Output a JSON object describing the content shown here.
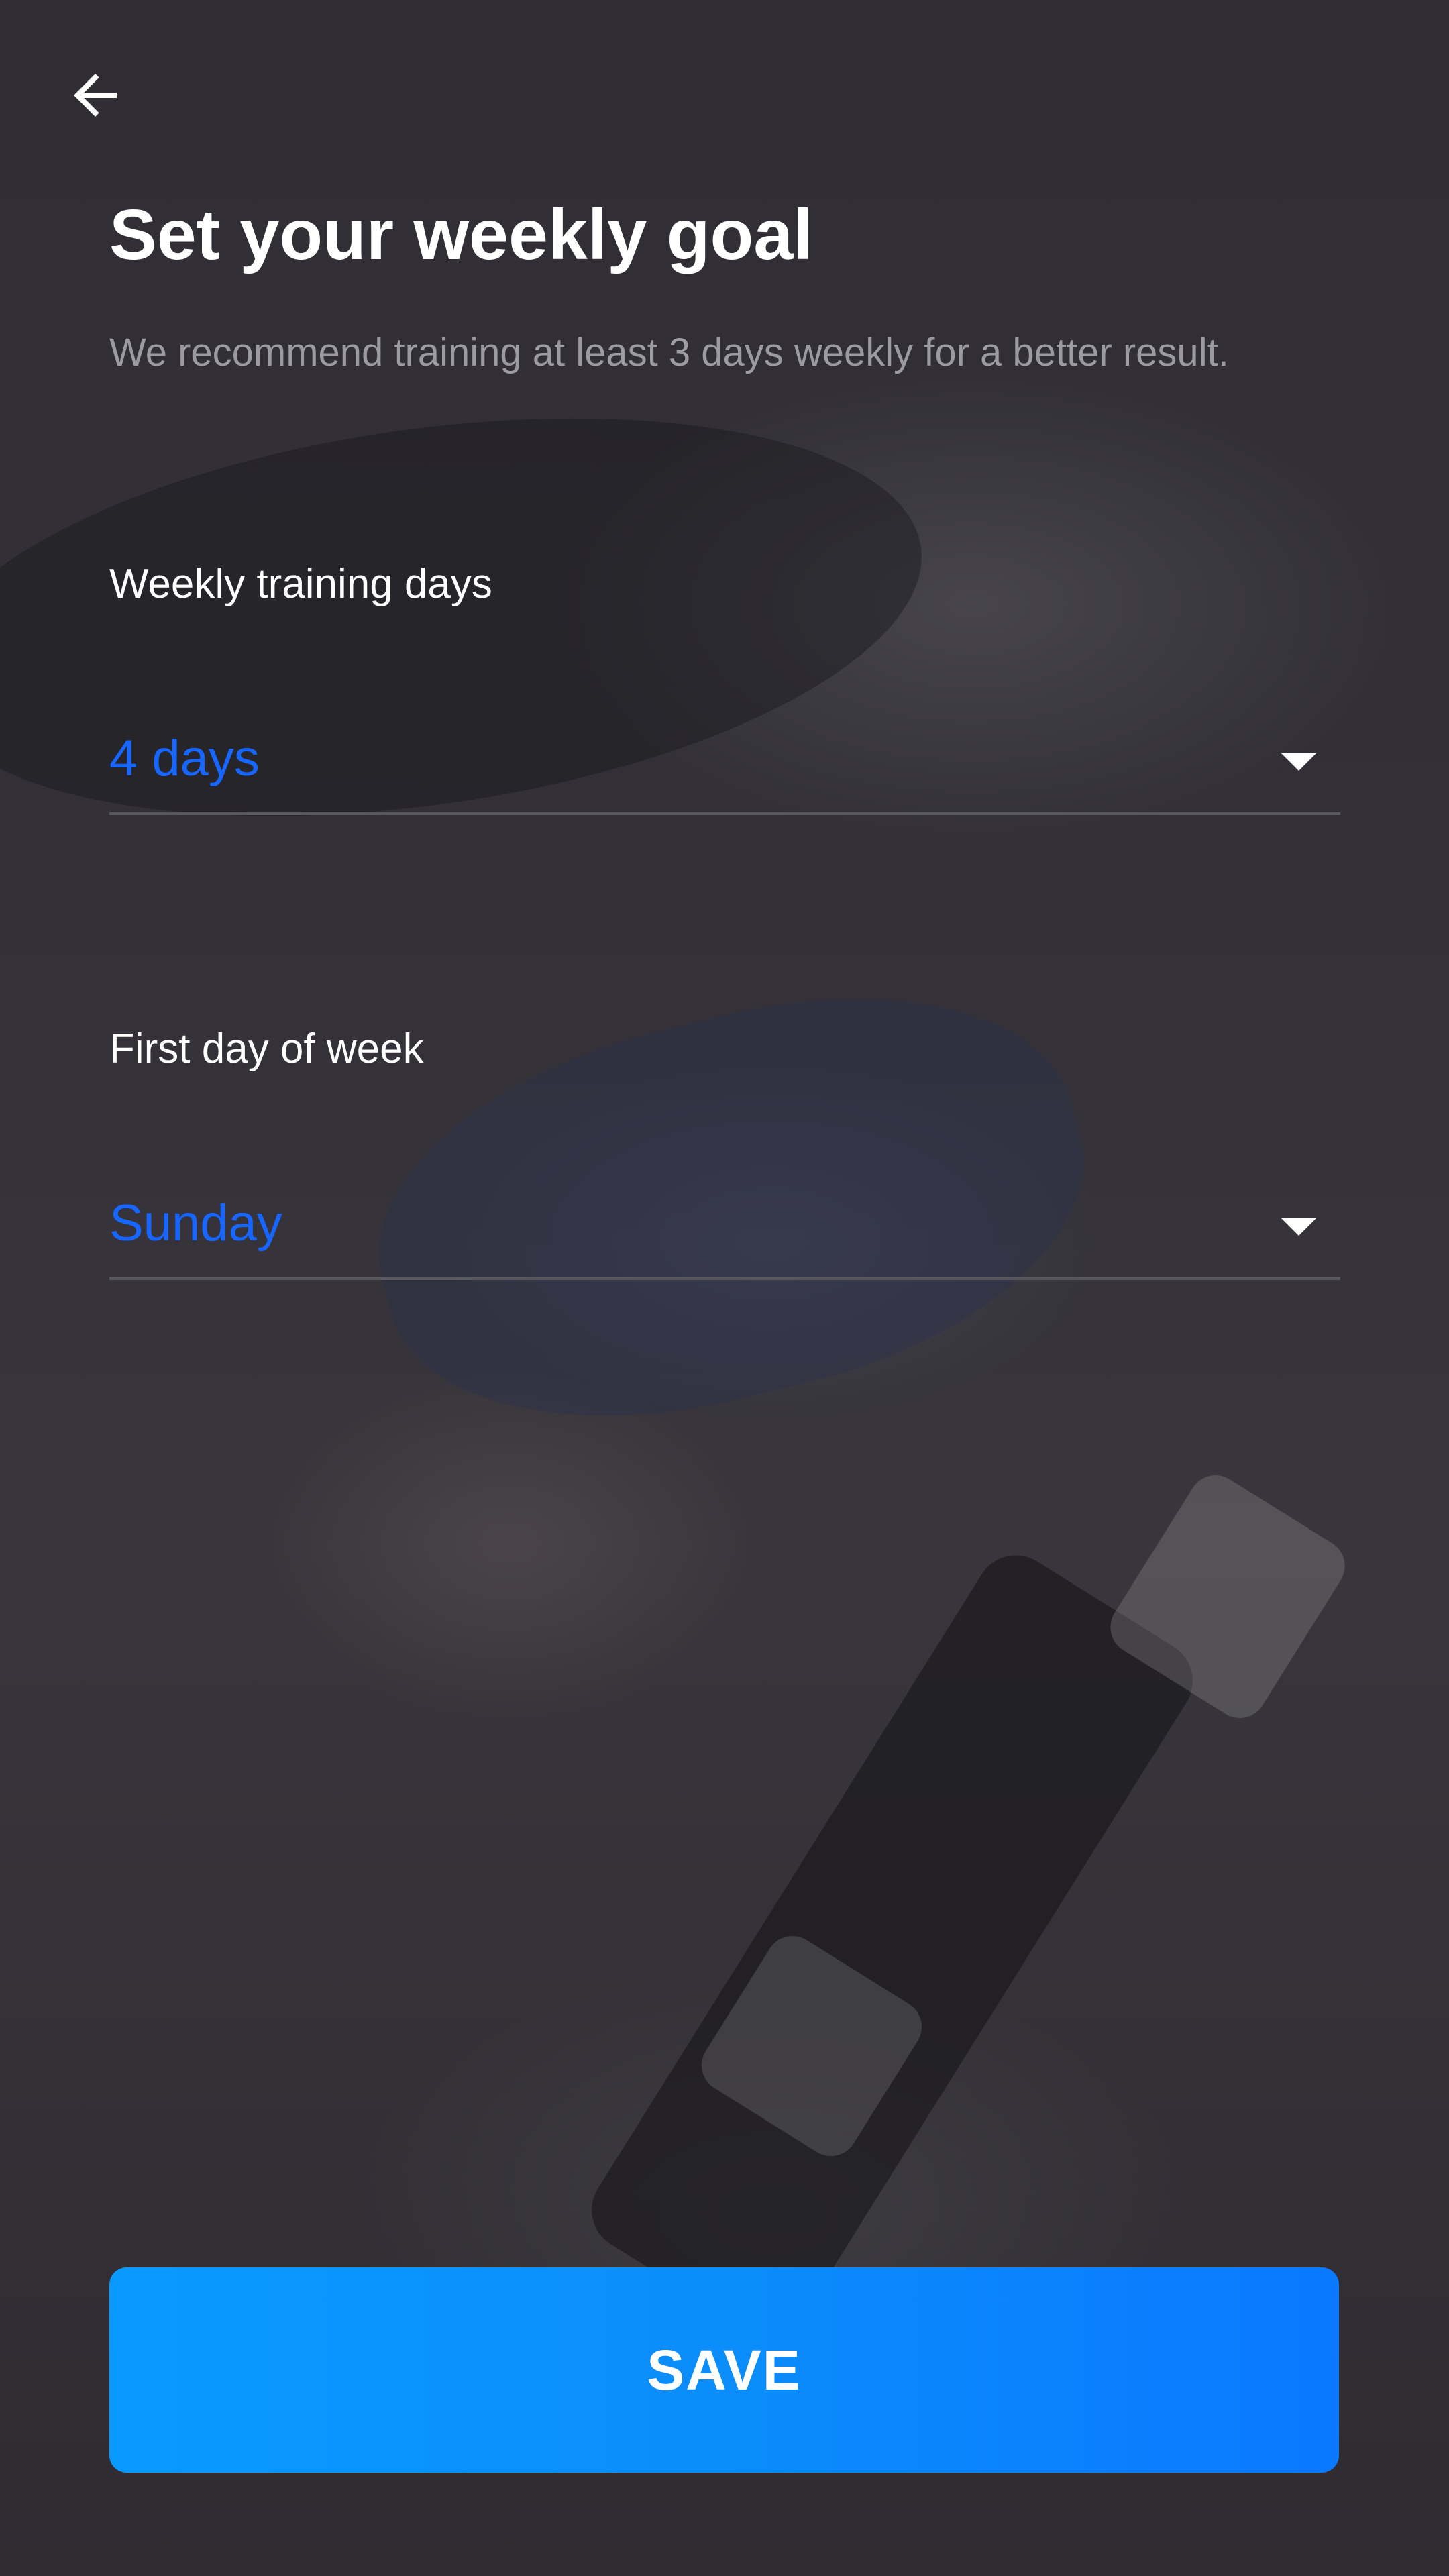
{
  "header": {
    "back_icon": "arrow-left-icon"
  },
  "title": "Set your weekly goal",
  "subtitle": "We recommend training at least 3 days weekly for a better result.",
  "fields": [
    {
      "label": "Weekly training days",
      "value": "4 days",
      "icon": "dropdown-arrow-icon"
    },
    {
      "label": "First day of week",
      "value": "Sunday",
      "icon": "dropdown-arrow-icon"
    }
  ],
  "save_button": {
    "label": "SAVE"
  },
  "colors": {
    "accent_text": "#1666ff",
    "button_start": "#0a9aff",
    "button_end": "#0a78ff",
    "background": "#2f2d33"
  }
}
